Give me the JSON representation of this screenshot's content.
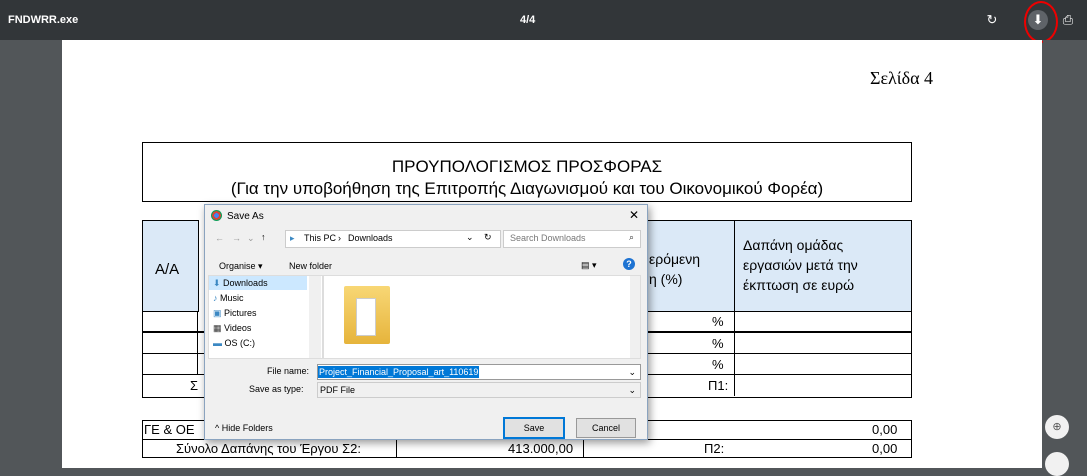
{
  "viewer": {
    "file_name": "FNDWRR.exe",
    "page_counter": "4/4"
  },
  "document": {
    "page_label": "Σελίδα 4",
    "title": "ΠΡΟΥΠΟΛΟΓΙΣΜΟΣ ΠΡΟΣΦΟΡΑΣ",
    "subtitle": "(Για την υποβοήθηση της Επιτροπής Διαγωνισμού και του Οικονομικού Φορέα)",
    "col_aa": "Α/Α",
    "col_discount_partial": "ερόμενη\nη (%)",
    "col_cost_after": "Δαπάνη ομάδας εργασιών μετά την έκπτωση σε ευρώ",
    "pct": "%",
    "p1": "Π1:",
    "p2": "Π2:",
    "s_partial": "Σ",
    "ge_oe": "ΓΕ & ΟΕ",
    "total_label": "Σύνολο Δαπάνης του Έργου  Σ2:",
    "total_value": "413.000,00",
    "zero1": "0,00",
    "zero2": "0,00"
  },
  "dialog": {
    "title": "Save As",
    "path_root": "This PC",
    "path_folder": "Downloads",
    "search_placeholder": "Search Downloads",
    "organise": "Organise ▾",
    "new_folder": "New folder",
    "nav_items": [
      "Downloads",
      "Music",
      "Pictures",
      "Videos",
      "OS (C:)"
    ],
    "file_name_label": "File name:",
    "file_name_value": "Project_Financial_Proposal_art_110619",
    "save_type_label": "Save as type:",
    "save_type_value": "PDF File",
    "hide_folders": "Hide Folders",
    "save": "Save",
    "cancel": "Cancel"
  },
  "colors": {
    "accent": "#0078d7",
    "highlight_circle": "#e00000"
  }
}
